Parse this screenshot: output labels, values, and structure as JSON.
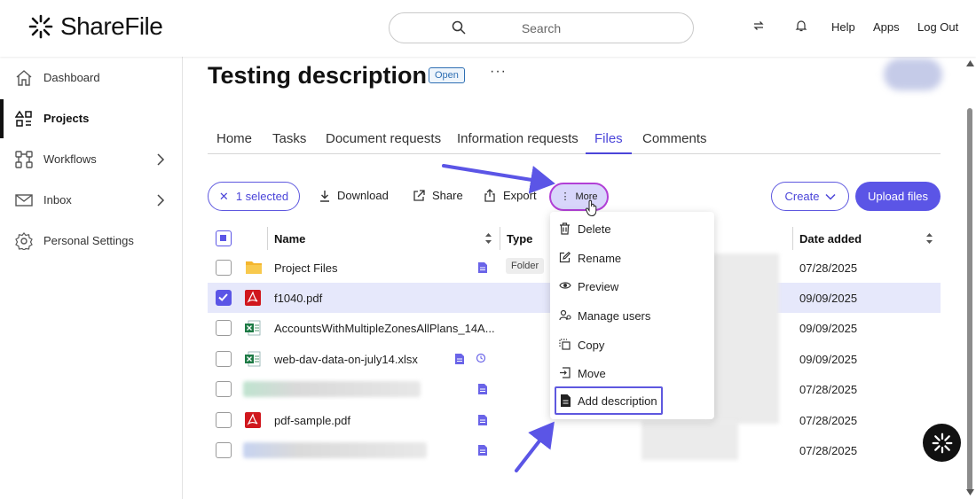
{
  "brand": {
    "name": "ShareFile",
    "accent": "#5b55e6"
  },
  "header": {
    "search_placeholder": "Search",
    "links": {
      "help": "Help",
      "apps": "Apps",
      "logout": "Log Out"
    }
  },
  "sidebar": {
    "items": [
      {
        "label": "Dashboard",
        "icon": "home-icon"
      },
      {
        "label": "Projects",
        "icon": "projects-icon",
        "active": true
      },
      {
        "label": "Workflows",
        "icon": "workflows-icon",
        "has_children": true
      },
      {
        "label": "Inbox",
        "icon": "inbox-icon",
        "has_children": true
      },
      {
        "label": "Personal Settings",
        "icon": "gear-icon"
      }
    ]
  },
  "project": {
    "title": "Testing description",
    "status": "Open",
    "more": "···"
  },
  "tabs": [
    "Home",
    "Tasks",
    "Document requests",
    "Information requests",
    "Files",
    "Comments"
  ],
  "active_tab": "Files",
  "toolbar": {
    "selected": "1 selected",
    "download": "Download",
    "share": "Share",
    "export": "Export",
    "more": "More",
    "create": "Create",
    "upload": "Upload files"
  },
  "table": {
    "headers": {
      "name": "Name",
      "type": "Type",
      "date": "Date added"
    },
    "rows": [
      {
        "name": "Project Files",
        "type": "Folder",
        "date": "07/28/2025",
        "icon": "folder-icon",
        "selected": false
      },
      {
        "name": "f1040.pdf",
        "type": "",
        "date": "09/09/2025",
        "icon": "pdf-icon",
        "selected": true
      },
      {
        "name": "AccountsWithMultipleZonesAllPlans_14A...",
        "type": "",
        "date": "09/09/2025",
        "icon": "excel-icon",
        "selected": false
      },
      {
        "name": "web-dav-data-on-july14.xlsx",
        "type": "",
        "date": "09/09/2025",
        "icon": "excel-icon",
        "selected": false
      },
      {
        "name": "",
        "type": "",
        "date": "07/28/2025",
        "icon": "blurred",
        "selected": false
      },
      {
        "name": "pdf-sample.pdf",
        "type": "",
        "date": "07/28/2025",
        "icon": "pdf-icon",
        "selected": false
      },
      {
        "name": "",
        "type": "",
        "date": "07/28/2025",
        "icon": "blurred",
        "selected": false
      }
    ]
  },
  "more_menu": {
    "items": [
      {
        "label": "Delete",
        "icon": "trash-icon"
      },
      {
        "label": "Rename",
        "icon": "edit-icon"
      },
      {
        "label": "Preview",
        "icon": "eye-icon"
      },
      {
        "label": "Manage users",
        "icon": "users-icon"
      },
      {
        "label": "Copy",
        "icon": "copy-icon"
      },
      {
        "label": "Move",
        "icon": "move-icon"
      },
      {
        "label": "Add description",
        "icon": "document-icon",
        "highlighted": true
      }
    ]
  }
}
